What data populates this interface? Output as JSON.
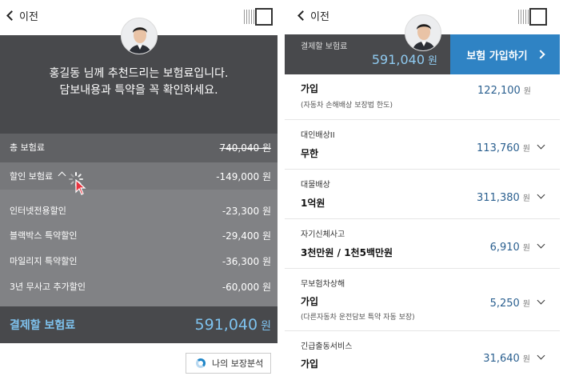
{
  "left": {
    "back_label": "이전",
    "headline_1": "홍길동 님께 추천드리는 보험료입니다.",
    "headline_2": "담보내용과 특약을 꼭 확인하세요.",
    "total": {
      "label": "총 보험료",
      "value": "740,040 원"
    },
    "discount": {
      "label": "할인 보험료",
      "value": "-149,000 원"
    },
    "discount_items": [
      {
        "label": "인터넷전용할인",
        "value": "-23,300 원"
      },
      {
        "label": "블랙박스 특약할인",
        "value": "-29,400 원"
      },
      {
        "label": "마일리지 특약할인",
        "value": "-36,300 원"
      },
      {
        "label": "3년 무사고 추가할인",
        "value": "-60,000 원"
      }
    ],
    "payment": {
      "label": "결제할 보험료",
      "amount": "591,040",
      "unit": "원"
    },
    "analysis_button": "나의 보장분석"
  },
  "right": {
    "back_label": "이전",
    "pay_label": "결제할 보험료",
    "pay_amount": "591,040",
    "pay_unit": "원",
    "cta_label": "보험 가입하기",
    "coverages": [
      {
        "name": "",
        "value": "가입",
        "note": "(자동차 손해배상 보장법 한도)",
        "price": "122,100",
        "unit": "원",
        "expandable": false
      },
      {
        "name": "대인배상II",
        "value": "무한",
        "note": "",
        "price": "113,760",
        "unit": "원",
        "expandable": true
      },
      {
        "name": "대물배상",
        "value": "1억원",
        "note": "",
        "price": "311,380",
        "unit": "원",
        "expandable": true
      },
      {
        "name": "자기신체사고",
        "value": "3천만원 / 1천5백만원",
        "note": "",
        "price": "6,910",
        "unit": "원",
        "expandable": true
      },
      {
        "name": "무보험차상해",
        "value": "가입",
        "note": "(다른자동차 운전담보 특약 자동 보장)",
        "price": "5,250",
        "unit": "원",
        "expandable": true
      },
      {
        "name": "긴급출동서비스",
        "value": "가입",
        "note": "",
        "price": "31,640",
        "unit": "원",
        "expandable": true
      }
    ]
  },
  "colors": {
    "dark": "#48494c",
    "accent_blue": "#2f83c4",
    "amount_blue": "#7ec2ee",
    "price_blue": "#2a5f8f"
  },
  "icons": [
    "back-chevron-icon",
    "menu-icon",
    "avatar",
    "donut-chart-icon",
    "loading-spinner-icon",
    "mouse-cursor-icon",
    "chevron-down-icon",
    "chevron-right-icon"
  ]
}
